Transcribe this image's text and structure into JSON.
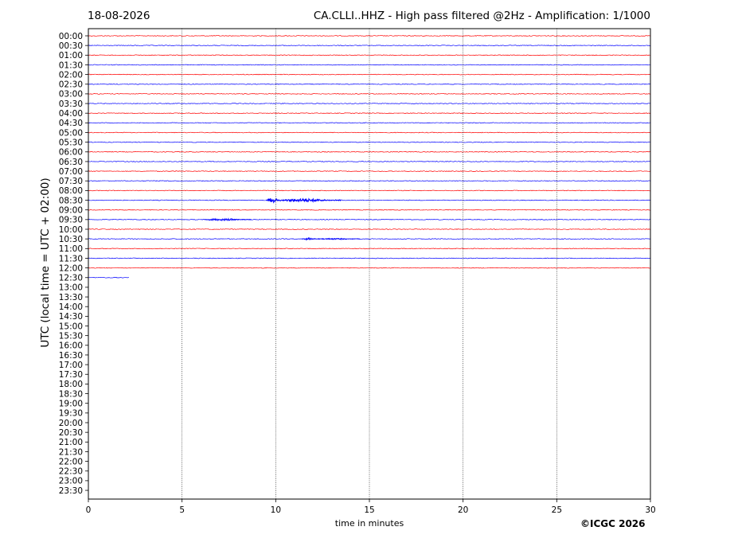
{
  "header": {
    "date": "18-08-2026",
    "title": "CA.CLLI..HHZ - High pass filtered @2Hz - Amplification: 1/1000"
  },
  "footer": {
    "copyright": "©ICGC 2026"
  },
  "chart_data": {
    "type": "line",
    "title": "CA.CLLI..HHZ - High pass filtered @2Hz - Amplification: 1/1000",
    "xlabel": "time in minutes",
    "ylabel": "UTC (local time = UTC + 02:00)",
    "xlim": [
      0,
      30
    ],
    "xticks": [
      "0",
      "5",
      "10",
      "15",
      "20",
      "25",
      "30"
    ],
    "rows": [
      "00:00",
      "00:30",
      "01:00",
      "01:30",
      "02:00",
      "02:30",
      "03:00",
      "03:30",
      "04:00",
      "04:30",
      "05:00",
      "05:30",
      "06:00",
      "06:30",
      "07:00",
      "07:30",
      "08:00",
      "08:30",
      "09:00",
      "09:30",
      "10:00",
      "10:30",
      "11:00",
      "11:30",
      "12:00",
      "12:30",
      "13:00",
      "13:30",
      "14:00",
      "14:30",
      "15:00",
      "15:30",
      "16:00",
      "16:30",
      "17:00",
      "17:30",
      "18:00",
      "18:30",
      "19:00",
      "19:30",
      "20:00",
      "20:30",
      "21:00",
      "21:30",
      "22:00",
      "22:30",
      "23:00",
      "23:30"
    ],
    "row_colors": [
      "#ff0000",
      "#0000ff"
    ],
    "grid": {
      "vertical_dotted": true
    },
    "last_trace": {
      "row": "12:30",
      "end_minute": 2.2
    },
    "events": [
      {
        "row": "08:30",
        "start": 9.5,
        "end": 10.3,
        "amplitude": "large"
      },
      {
        "row": "08:30",
        "start": 10.3,
        "end": 13.5,
        "amplitude": "medium"
      },
      {
        "row": "09:30",
        "start": 6.2,
        "end": 8.7,
        "amplitude": "small"
      },
      {
        "row": "10:30",
        "start": 11.4,
        "end": 12.3,
        "amplitude": "small"
      },
      {
        "row": "10:30",
        "start": 12.3,
        "end": 14.5,
        "amplitude": "tiny"
      }
    ]
  }
}
